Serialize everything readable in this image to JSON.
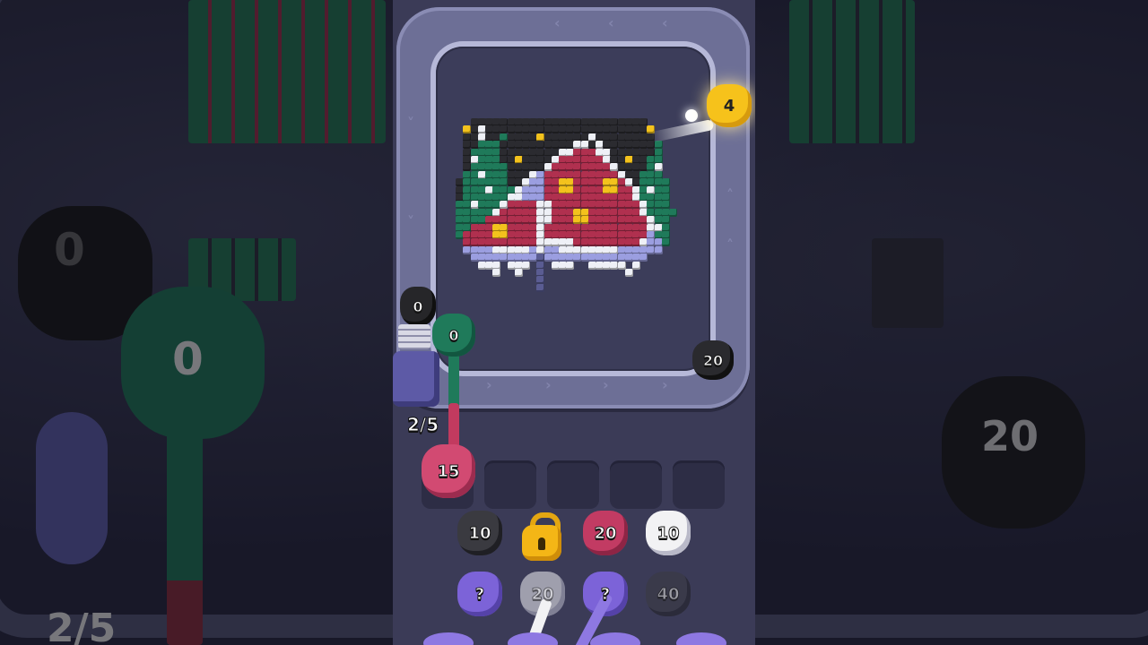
{
  "background": {
    "left_fist_label": "0",
    "left_green_fist_label": "0",
    "left_counter": "2/5",
    "right_fist_label": "20"
  },
  "board": {
    "yellow_fist": "4",
    "black_fist_right": "20",
    "black_fist_left": "0",
    "green_fist": "0",
    "counter": "2/5",
    "active_fist": "15"
  },
  "queue_grid": {
    "row1": [
      {
        "label": "10",
        "color": "#3a3a40",
        "type": "black"
      },
      {
        "label": "",
        "type": "locked",
        "icon": "padlock-icon"
      },
      {
        "label": "20",
        "color": "#c23b63",
        "type": "pink"
      },
      {
        "label": "10",
        "color": "#f2f2f4",
        "type": "white"
      }
    ],
    "row2": [
      {
        "label": "?",
        "color": "#7c63d8",
        "type": "mystery"
      },
      {
        "label": "20",
        "color": "#f2f2f4",
        "type": "white"
      },
      {
        "label": "?",
        "color": "#7c63d8",
        "type": "mystery"
      },
      {
        "label": "40",
        "color": "#3a3a40",
        "type": "black"
      }
    ]
  },
  "colors": {
    "panel": "#3b3b57",
    "rail": "#6d6f96",
    "pink": "#c23b63",
    "green": "#1f7a5a",
    "yellow": "#f6c21b"
  }
}
